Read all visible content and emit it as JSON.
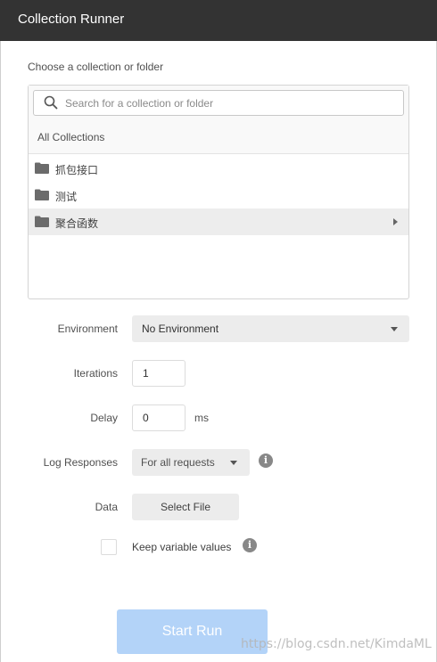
{
  "window": {
    "title": "Collection Runner"
  },
  "picker": {
    "choose_label": "Choose a collection or folder",
    "search_placeholder": "Search for a collection or folder",
    "all_collections": "All Collections",
    "items": [
      {
        "label": "抓包接口",
        "selected": false
      },
      {
        "label": "测试",
        "selected": false
      },
      {
        "label": "聚合函数",
        "selected": true
      }
    ]
  },
  "settings": {
    "environment": {
      "label": "Environment",
      "value": "No Environment"
    },
    "iterations": {
      "label": "Iterations",
      "value": "1"
    },
    "delay": {
      "label": "Delay",
      "value": "0",
      "unit": "ms"
    },
    "log_responses": {
      "label": "Log Responses",
      "value": "For all requests"
    },
    "data": {
      "label": "Data",
      "button": "Select File"
    },
    "keep_variables": {
      "label": "Keep variable values",
      "checked": false
    }
  },
  "actions": {
    "start_run": "Start Run"
  },
  "watermark": "https://blog.csdn.net/KimdaML",
  "colors": {
    "titlebar": "#333333",
    "start_button": "#b3d3f8",
    "selected_row": "#ededed"
  }
}
